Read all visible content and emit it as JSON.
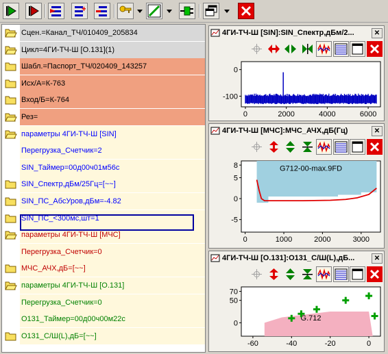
{
  "toolbar": {
    "buttons": [
      "play-icon",
      "step-icon",
      "insert-red-icon",
      "insert-blue-icon",
      "remove-icon",
      "key-icon",
      "line-icon",
      "connect-icon",
      "windows-icon",
      "close-icon"
    ]
  },
  "tree": {
    "rows": [
      {
        "text": "Сцен.=Канал_ТЧ/010409_205834",
        "bg": "#d8d8d8",
        "color": "#000000",
        "folder": "open"
      },
      {
        "text": "Цикл=4ГИ-ТЧ-Ш [O.131](1)",
        "bg": "#d8d8d8",
        "color": "#000000",
        "folder": "open"
      },
      {
        "text": "Шабл.=Паспорт_ТЧ/020409_143257",
        "bg": "#f0a080",
        "color": "#000000",
        "folder": "closed"
      },
      {
        "text": "Исх/А=К-763",
        "bg": "#f0a080",
        "color": "#000000",
        "folder": "closed"
      },
      {
        "text": "Вход/Б=К-764",
        "bg": "#f0a080",
        "color": "#000000",
        "folder": "closed"
      },
      {
        "text": "Рез=",
        "bg": "#f0a080",
        "color": "#000000",
        "folder": "open"
      },
      {
        "text": "параметры 4ГИ-ТЧ-Ш [SIN]",
        "bg": "#fff8dc",
        "color": "#0000ff",
        "folder": "open"
      },
      {
        "text": "Перегрузка_Счетчик=2",
        "bg": "#fff8dc",
        "color": "#0000ff",
        "folder": "none"
      },
      {
        "text": "SIN_Таймер=00д00ч01м56с",
        "bg": "#fff8dc",
        "color": "#0000ff",
        "folder": "none"
      },
      {
        "text": "SIN_Спектр,дБм/25Гц=[~~]",
        "bg": "#fff8dc",
        "color": "#0000ff",
        "folder": "closed"
      },
      {
        "text": "SIN_ПС_АбсУров,дБм=-4.82",
        "bg": "#fff8dc",
        "color": "#0000ff",
        "folder": "closed"
      },
      {
        "text": "SIN_ПС_<300мс,шт=1",
        "bg": "#fff8dc",
        "color": "#0000ff",
        "folder": "closed"
      },
      {
        "text": "параметры 4ГИ-ТЧ-Ш [МЧС]",
        "bg": "#fff8dc",
        "color": "#c00000",
        "folder": "open"
      },
      {
        "text": "Перегрузка_Счетчик=0",
        "bg": "#fff8dc",
        "color": "#c00000",
        "folder": "none"
      },
      {
        "text": "МЧС_АЧХ,дБ=[~~]",
        "bg": "#fff8dc",
        "color": "#c00000",
        "folder": "closed"
      },
      {
        "text": "параметры 4ГИ-ТЧ-Ш [O.131]",
        "bg": "#fff8dc",
        "color": "#008000",
        "folder": "open"
      },
      {
        "text": "Перегрузка_Счетчик=0",
        "bg": "#fff8dc",
        "color": "#008000",
        "folder": "none"
      },
      {
        "text": "O131_Таймер=00д00ч00м22с",
        "bg": "#fff8dc",
        "color": "#008000",
        "folder": "none"
      },
      {
        "text": "O131_С/Ш(L),дБ=[~~]",
        "bg": "#fff8dc",
        "color": "#008000",
        "folder": "closed"
      }
    ]
  },
  "panels": [
    {
      "title": "4ГИ-ТЧ-Ш [SIN]:SIN_Спектр,дБм/2...",
      "close": "✕"
    },
    {
      "title": "4ГИ-ТЧ-Ш [МЧС]:МЧС_АЧХ,дБ(Гц)",
      "close": "✕"
    },
    {
      "title": "4ГИ-ТЧ-Ш [O.131]:O131_С/Ш(L),дБ...",
      "close": "✕"
    }
  ],
  "chart_data": [
    {
      "type": "line",
      "x_ticks": [
        "0",
        "2000",
        "4000",
        "6000"
      ],
      "y_ticks": [
        "0",
        "-100"
      ],
      "xlim": [
        -200,
        6600
      ],
      "ylim": [
        -140,
        30
      ],
      "noise_floor": -110,
      "peak": {
        "x": 1850,
        "y": -10
      },
      "color": "#0000c0"
    },
    {
      "type": "line",
      "x_ticks": [
        "0",
        "1000",
        "2000",
        "3000"
      ],
      "y_ticks": [
        "8",
        "5",
        "0",
        "-5"
      ],
      "xlim": [
        -100,
        3500
      ],
      "ylim": [
        -8,
        9
      ],
      "annotation": "G712-00-max.9FD",
      "curve": [
        [
          300,
          4.5
        ],
        [
          360,
          2
        ],
        [
          420,
          0
        ],
        [
          500,
          -0.5
        ],
        [
          800,
          -0.5
        ],
        [
          1500,
          -0.5
        ],
        [
          2200,
          -0.4
        ],
        [
          2600,
          -0.2
        ],
        [
          2900,
          0.2
        ],
        [
          3200,
          1
        ],
        [
          3400,
          2.5
        ]
      ],
      "mask_color": "#a0d0e0",
      "line_color": "#e00000"
    },
    {
      "type": "scatter",
      "x_ticks": [
        "-60",
        "-40",
        "-20",
        "0"
      ],
      "y_ticks": [
        "70",
        "50",
        "0"
      ],
      "xlim": [
        -66,
        6
      ],
      "ylim": [
        -30,
        80
      ],
      "annotation": "G.712",
      "points": [
        [
          -40,
          10
        ],
        [
          -35,
          20
        ],
        [
          -27,
          30
        ],
        [
          -12,
          50
        ],
        [
          0,
          60
        ],
        [
          3,
          15
        ]
      ],
      "point_color": "#00a000",
      "region_color": "#f4b0c0"
    }
  ]
}
